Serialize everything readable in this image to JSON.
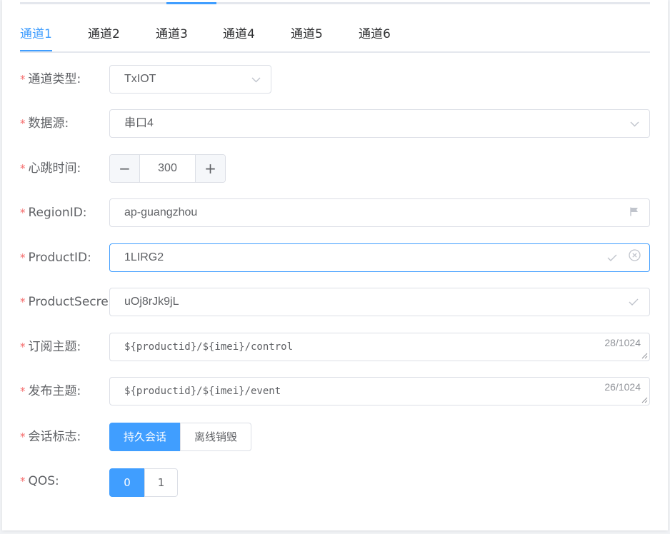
{
  "tabs": [
    "通道1",
    "通道2",
    "通道3",
    "通道4",
    "通道5",
    "通道6"
  ],
  "active_tab": "通道1",
  "form": {
    "channel_type": {
      "label": "通道类型:",
      "value": "TxIOT"
    },
    "data_source": {
      "label": "数据源:",
      "value": "串口4"
    },
    "heartbeat": {
      "label": "心跳时间:",
      "value": "300",
      "minus": "−",
      "plus": "+"
    },
    "region_id": {
      "label": "RegionID:",
      "value": "ap-guangzhou"
    },
    "product_id": {
      "label": "ProductID:",
      "value": "1LIRG2"
    },
    "product_secret": {
      "label": "ProductSecret:",
      "value": "uOj8rJk9jL"
    },
    "subscribe_topic": {
      "label": "订阅主题:",
      "value": "${productid}/${imei}/control",
      "counter": "28/1024"
    },
    "publish_topic": {
      "label": "发布主题:",
      "value": "${productid}/${imei}/event",
      "counter": "26/1024"
    },
    "session_flag": {
      "label": "会话标志:",
      "options": [
        "持久会话",
        "离线销毁"
      ],
      "selected": "持久会话"
    },
    "qos": {
      "label": "QOS:",
      "options": [
        "0",
        "1"
      ],
      "selected": "0"
    }
  },
  "required_mark": "*",
  "colors": {
    "accent": "#409eff",
    "required": "#f56c6c",
    "border": "#dcdfe6"
  }
}
